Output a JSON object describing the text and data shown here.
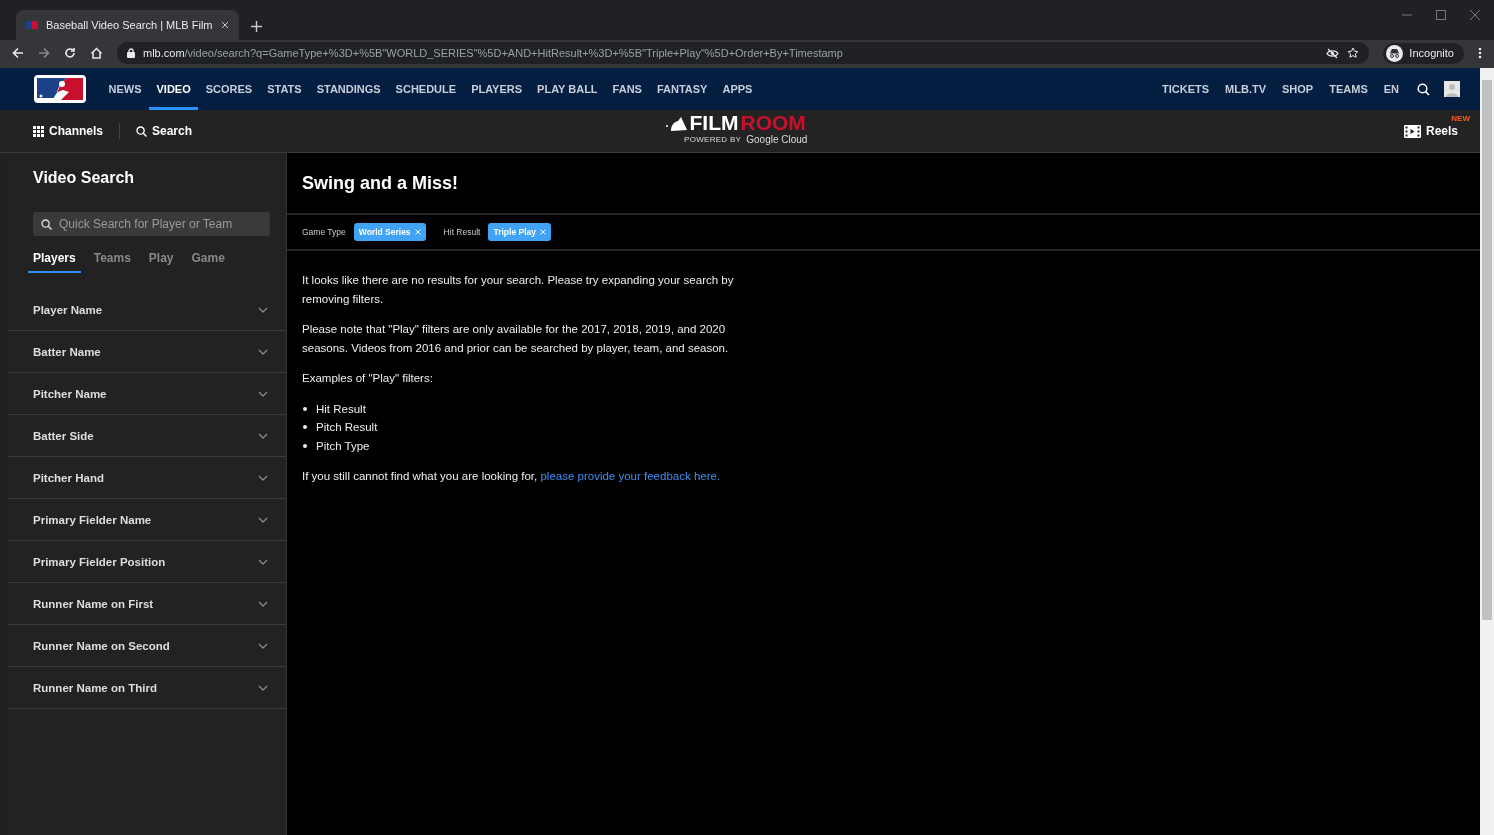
{
  "browser": {
    "tab_title": "Baseball Video Search | MLB Film",
    "url_host": "mlb.com",
    "url_path": "/video/search?q=GameType+%3D+%5B\"WORLD_SERIES\"%5D+AND+HitResult+%3D+%5B\"Triple+Play\"%5D+Order+By+Timestamp",
    "profile": "Incognito"
  },
  "nav": {
    "left": [
      {
        "label": "NEWS",
        "selected": false
      },
      {
        "label": "VIDEO",
        "selected": true
      },
      {
        "label": "SCORES",
        "selected": false
      },
      {
        "label": "STATS",
        "selected": false
      },
      {
        "label": "STANDINGS",
        "selected": false
      },
      {
        "label": "SCHEDULE",
        "selected": false
      },
      {
        "label": "PLAYERS",
        "selected": false
      },
      {
        "label": "PLAY BALL",
        "selected": false
      },
      {
        "label": "FANS",
        "selected": false
      },
      {
        "label": "FANTASY",
        "selected": false
      },
      {
        "label": "APPS",
        "selected": false
      }
    ],
    "right": [
      "TICKETS",
      "MLB.TV",
      "SHOP",
      "TEAMS",
      "EN"
    ]
  },
  "subbar": {
    "channels": "Channels",
    "search": "Search",
    "logo": {
      "film": "FILM",
      "room": "ROOM",
      "powered": "POWERED BY",
      "cloud": "Google Cloud"
    },
    "reels": "Reels",
    "reels_badge": "NEW"
  },
  "sidebar": {
    "title": "Video Search",
    "placeholder": "Quick Search for Player or Team",
    "tabs": [
      {
        "label": "Players",
        "selected": true
      },
      {
        "label": "Teams",
        "selected": false
      },
      {
        "label": "Play",
        "selected": false
      },
      {
        "label": "Game",
        "selected": false
      }
    ],
    "filters": [
      {
        "label": "Player Name",
        "expanded": false
      },
      {
        "label": "Batter Name",
        "expanded": false
      },
      {
        "label": "Pitcher Name",
        "expanded": false
      },
      {
        "label": "Batter Side",
        "expanded": false
      },
      {
        "label": "Pitcher Hand",
        "expanded": false
      },
      {
        "label": "Primary Fielder Name",
        "expanded": false
      },
      {
        "label": "Primary Fielder Position",
        "expanded": false
      },
      {
        "label": "Runner Name on First",
        "expanded": false
      },
      {
        "label": "Runner Name on Second",
        "expanded": false
      },
      {
        "label": "Runner Name on Third",
        "expanded": false
      }
    ]
  },
  "main": {
    "title": "Swing and a Miss!",
    "active_filters": [
      {
        "label": "Game Type",
        "value": "World Series"
      },
      {
        "label": "Hit Result",
        "value": "Triple Play"
      }
    ],
    "paragraphs": [
      "It looks like there are no results for your search. Please try expanding your search by removing filters.",
      "Please note that \"Play\" filters are only available for the 2017, 2018, 2019, and 2020 seasons. Videos from 2016 and prior can be searched by player, team, and season.",
      "Examples of \"Play\" filters:"
    ],
    "examples": [
      "Hit Result",
      "Pitch Result",
      "Pitch Type"
    ],
    "feedback_text": "If you still cannot find what you are looking for,",
    "feedback_link": "please provide your feedback here."
  }
}
